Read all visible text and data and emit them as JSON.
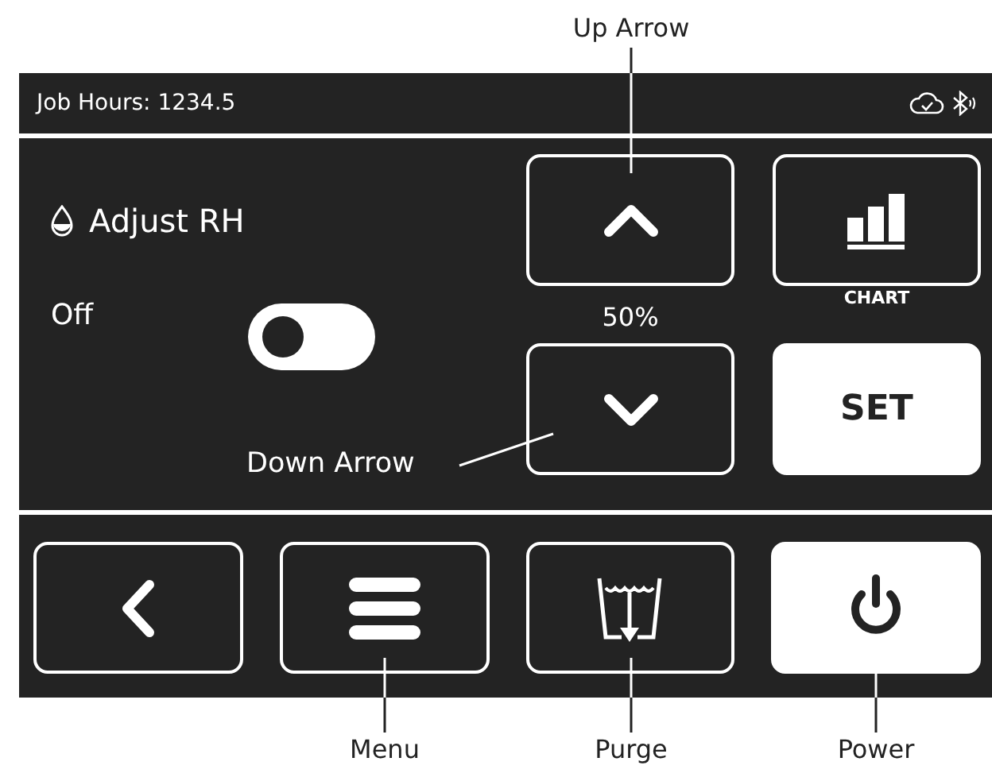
{
  "callouts": [
    {
      "label": "Up Arrow",
      "kind": "up"
    },
    {
      "label": "Down Arrow",
      "kind": "down"
    },
    {
      "label": "Menu",
      "kind": "menu"
    },
    {
      "label": "Purge",
      "kind": "purge"
    },
    {
      "label": "Power",
      "kind": "power"
    }
  ],
  "status_bar": {
    "job_hours": "Job Hours: 1234.5"
  },
  "mode": {
    "title": "Adjust RH"
  },
  "toggle": {
    "label": "Off",
    "on": false
  },
  "setpoint": {
    "reading": "50%"
  },
  "chart_button": {
    "label": "CHART"
  },
  "set_button": {
    "label": "SET"
  }
}
